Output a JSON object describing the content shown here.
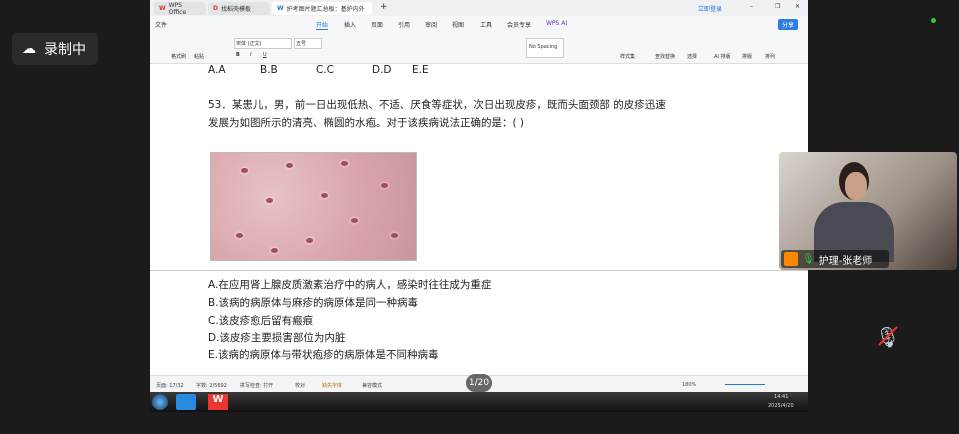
{
  "recording": {
    "label": "录制中"
  },
  "tabs": [
    {
      "label": "WPS Office"
    },
    {
      "label": "找稻壳模板"
    },
    {
      "label": "护考图片题汇总板：基护内外"
    }
  ],
  "login": "立即登录",
  "menu": {
    "file": "文件",
    "items": [
      "开始",
      "插入",
      "页面",
      "引用",
      "审阅",
      "视图",
      "工具",
      "会员专享",
      "WPS AI"
    ],
    "active": "开始",
    "share": "分享"
  },
  "ribbon": {
    "format_painter": "格式刷",
    "paste": "粘贴",
    "font": "宋体 (正文)",
    "size": "五号",
    "style_box": "No Spacing",
    "styles": "样式集",
    "find_replace": "查找替换",
    "select": "选择",
    "ai_layout": "AI 排版",
    "layout": "排版",
    "arrange": "排列"
  },
  "doc": {
    "prev_options": [
      "A.A",
      "B.B",
      "C.C",
      "D.D",
      "E.E"
    ],
    "question_line1": "53．某患儿，男，前一日出现低热、不适、厌食等症状，次日出现皮疹，既而头面颈部  的皮疹迅速",
    "question_line2": "发展为如图所示的清亮、椭圆的水疱。对于该疾病说法正确的是：(          )",
    "options": [
      "A.在应用肾上腺皮质激素治疗中的病人，感染时往往成为重症",
      "B.该病的病原体与麻疹的病原体是同一种病毒",
      "C.该皮疹愈后留有瘢痕",
      "D.该皮疹主要损害部位为内脏",
      "E.该病的病原体与带状疱疹的病原体是不同种病毒"
    ]
  },
  "status": {
    "page": "页面: 17/32",
    "words": "字数: 2/5692",
    "spell": "拼写检查: 打开",
    "proof": "校对",
    "missing_font": "缺失字体",
    "mode": "兼容模式",
    "zoom": "180%"
  },
  "pager": "1/20",
  "clock": {
    "time": "14:41",
    "date": "2025/4/20"
  },
  "camera": {
    "name": "护理-张老师"
  }
}
